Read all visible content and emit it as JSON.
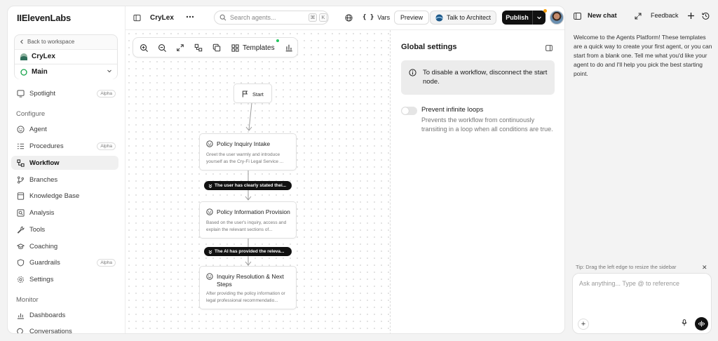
{
  "app": {
    "logo": "IIElevenLabs"
  },
  "sidebar": {
    "back_label": "Back to workspace",
    "agent_name": "CryLex",
    "branch_name": "Main",
    "sections": {
      "configure": "Configure",
      "monitor": "Monitor"
    },
    "items": [
      {
        "label": "Spotlight",
        "badge": "Alpha"
      },
      {
        "label": "Agent",
        "badge": ""
      },
      {
        "label": "Procedures",
        "badge": "Alpha"
      },
      {
        "label": "Workflow",
        "badge": "",
        "active": true
      },
      {
        "label": "Branches",
        "badge": ""
      },
      {
        "label": "Knowledge Base",
        "badge": ""
      },
      {
        "label": "Analysis",
        "badge": ""
      },
      {
        "label": "Tools",
        "badge": ""
      },
      {
        "label": "Coaching",
        "badge": ""
      },
      {
        "label": "Guardrails",
        "badge": "Alpha"
      },
      {
        "label": "Settings",
        "badge": ""
      },
      {
        "label": "Dashboards",
        "badge": ""
      },
      {
        "label": "Conversations",
        "badge": ""
      }
    ]
  },
  "topbar": {
    "agent_title": "CryLex",
    "search_placeholder": "Search agents...",
    "kbd_cmd": "⌘",
    "kbd_k": "K",
    "vars_label": "Vars",
    "preview_label": "Preview",
    "architect_label": "Talk to Architect",
    "publish_label": "Publish"
  },
  "canvas": {
    "templates_label": "Templates",
    "start_label": "Start",
    "nodes": [
      {
        "title": "Policy Inquiry Intake",
        "desc": "Greet the user warmly and introduce yourself as the Cry-Fi Legal Service ..."
      },
      {
        "title": "Policy Information Provision",
        "desc": "Based on the user's inquiry, access and explain the relevant sections of..."
      },
      {
        "title": "Inquiry Resolution & Next Steps",
        "desc": "After providing the policy information or legal professional recommendatio..."
      }
    ],
    "edges": [
      {
        "label": "The user has clearly stated thei..."
      },
      {
        "label": "The AI has provided the releva..."
      }
    ]
  },
  "global_settings": {
    "title": "Global settings",
    "info": "To disable a workflow, disconnect the start node.",
    "loops_title": "Prevent infinite loops",
    "loops_desc": "Prevents the workflow from continuously transiting in a loop when all conditions are true.",
    "loops_enabled": false
  },
  "chat": {
    "new_chat_label": "New chat",
    "feedback_label": "Feedback",
    "welcome": "Welcome to the Agents Platform! These templates are a quick way to create your first agent, or you can start from a blank one. Tell me what you'd like your agent to do and I'll help you pick the best starting point.",
    "tip": "Tip: Drag the left edge to resize the sidebar",
    "input_placeholder": "Ask anything... Type @ to reference"
  },
  "colors": {
    "accent_dark": "#111111",
    "status_green": "#22c55e",
    "publish_dot": "#f59e0b"
  }
}
